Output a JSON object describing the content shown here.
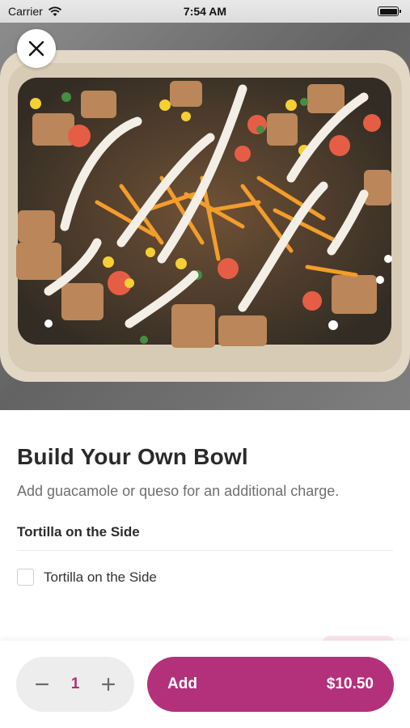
{
  "status_bar": {
    "carrier": "Carrier",
    "time": "7:54 AM"
  },
  "hero": {
    "image_alt": "bowl-food-photo"
  },
  "item": {
    "title": "Build Your Own Bowl",
    "description": "Add guacamole or queso for an additional charge."
  },
  "options": {
    "section_title": "Tortilla on the Side",
    "items": [
      {
        "label": "Tortilla on the Side",
        "checked": false
      }
    ]
  },
  "cart": {
    "quantity": "1",
    "add_label": "Add",
    "price": "$10.50"
  },
  "colors": {
    "accent": "#b3307a",
    "stepper_bg": "#ededed",
    "text_primary": "#2a2a2a",
    "text_secondary": "#6f6f6f"
  }
}
